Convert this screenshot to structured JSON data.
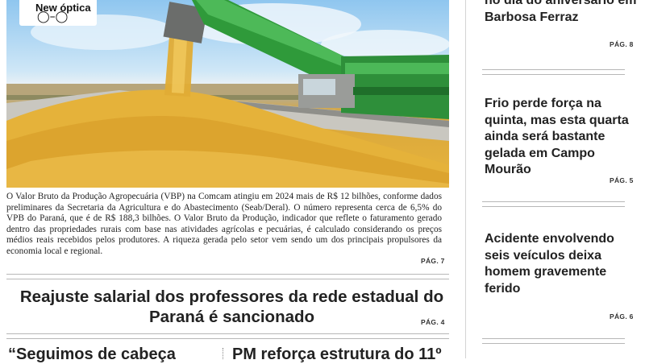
{
  "photo": {
    "logo_text": "New óptica",
    "logo_icon": "glasses-icon"
  },
  "lead_story": {
    "caption": "O Valor Bruto da Produção Agropecuária (VBP) na Comcam atingiu em 2024 mais de R$ 12 bilhões, conforme dados preliminares da Secretaria da Agricultura e do Abastecimento (Seab/Deral). O número representa cerca de 6,5% do VPB do Paraná, que é de R$ 188,3 bilhões. O Valor Bruto da Produção, indicador que reflete o faturamento gerado dentro das propriedades rurais com base nas atividades agrícolas e pecuárias, é calculado considerando os preços médios reais recebidos pelos produtores. A riqueza gerada pelo setor vem sendo um dos principais propulsores da economia local e regional.",
    "page": "PÁG. 7"
  },
  "second_story": {
    "headline": "Reajuste salarial dos professores da rede estadual do Paraná é sancionado",
    "page": "PÁG. 4"
  },
  "bottom_stories": [
    {
      "text": "“Seguimos de cabeça"
    },
    {
      "text": "PM reforça estrutura do 11º"
    }
  ],
  "sidebar": [
    {
      "headline": "no dia do aniversário em Barbosa Ferraz",
      "page": "PÁG. 8"
    },
    {
      "headline": "Frio perde força na quinta, mas esta quarta ainda será bastante gelada em Campo Mourão",
      "page": "PÁG. 5"
    },
    {
      "headline": "Acidente envolvendo seis veículos deixa homem gravemente ferido",
      "page": "PÁG. 6"
    }
  ]
}
